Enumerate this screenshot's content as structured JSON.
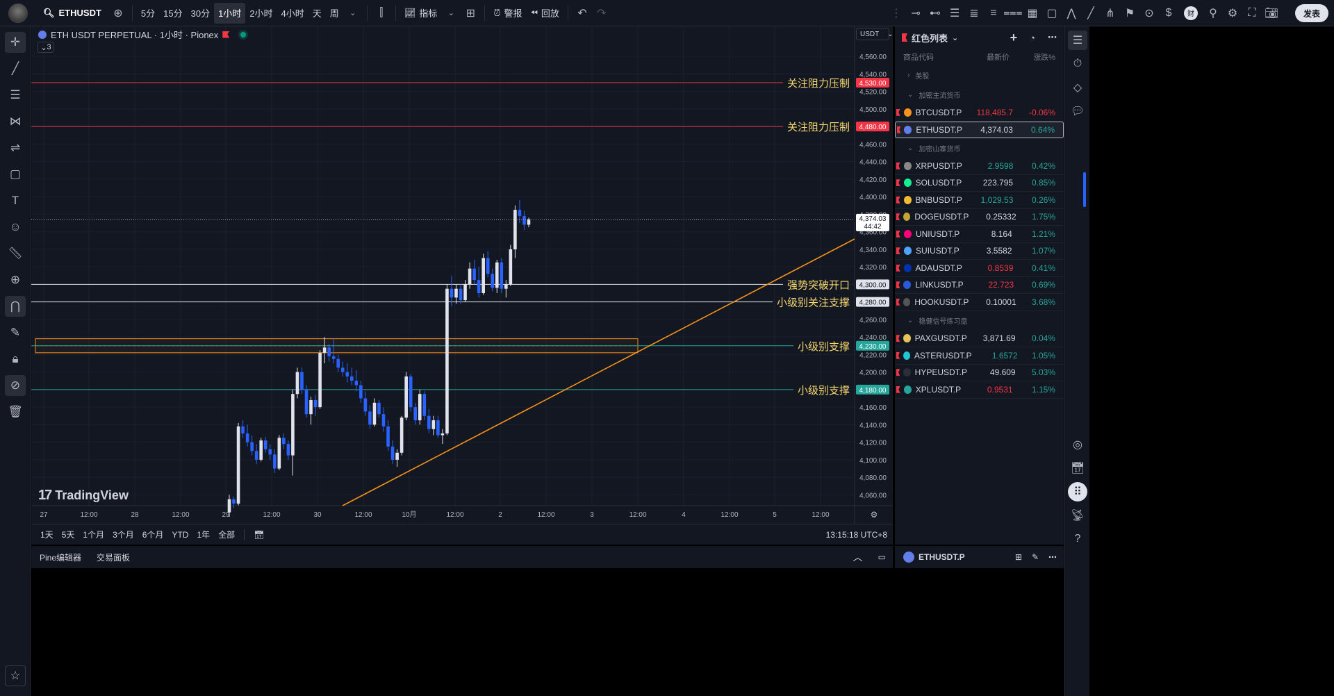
{
  "topbar": {
    "symbol": "ETHUSDT",
    "timeframes": [
      "5分",
      "15分",
      "30分",
      "1小时",
      "2小时",
      "4小时",
      "天",
      "周"
    ],
    "active_timeframe": "1小时",
    "indicators_label": "指标",
    "alert_label": "警报",
    "replay_label": "回放",
    "publish_label": "发表"
  },
  "chart": {
    "title": "ETH USDT PERPETUAL · 1小时 · Pionex",
    "collapse_count": "3",
    "currency": "USDT",
    "watermark": "TradingView",
    "annotations": [
      {
        "text": "关注阻力压制",
        "price": 4530,
        "color": "#f23645",
        "tag": "4,530.00"
      },
      {
        "text": "关注阻力压制",
        "price": 4480,
        "color": "#f23645",
        "tag": "4,480.00"
      },
      {
        "text": "强势突破开口",
        "price": 4300,
        "color": "#e0e3eb",
        "tag": "4,300.00"
      },
      {
        "text": "小级别关注支撑",
        "price": 4280,
        "color": "#e0e3eb",
        "tag": "4,280.00"
      },
      {
        "text": "小级别支撑",
        "price": 4230,
        "color": "#26a69a",
        "tag": "4,230.00"
      },
      {
        "text": "小级别支撑",
        "price": 4180,
        "color": "#26a69a",
        "tag": "4,180.00"
      }
    ],
    "last_price": "4,374.03",
    "countdown": "44:42",
    "price_ticks": [
      "4,560.00",
      "4,540.00",
      "4,520.00",
      "4,500.00",
      "4,480.00",
      "4,460.00",
      "4,440.00",
      "4,420.00",
      "4,400.00",
      "4,380.00",
      "4,360.00",
      "4,340.00",
      "4,320.00",
      "4,300.00",
      "4,280.00",
      "4,260.00",
      "4,240.00",
      "4,220.00",
      "4,200.00",
      "4,180.00",
      "4,160.00",
      "4,140.00",
      "4,120.00",
      "4,100.00",
      "4,080.00",
      "4,060.00"
    ],
    "time_ticks": [
      "27",
      "12:00",
      "28",
      "12:00",
      "29",
      "12:00",
      "30",
      "12:00",
      "10月",
      "12:00",
      "2",
      "12:00",
      "3",
      "12:00",
      "4",
      "12:00",
      "5",
      "12:00"
    ]
  },
  "timeframe_bar": {
    "ranges": [
      "1天",
      "5天",
      "1个月",
      "3个月",
      "6个月",
      "YTD",
      "1年",
      "全部"
    ],
    "clock": "13:15:18 UTC+8"
  },
  "bottom_tabs": [
    "Pine编辑器",
    "交易面板"
  ],
  "watchlist": {
    "title": "红色列表",
    "columns": [
      "商品代码",
      "最新价",
      "涨跌%"
    ],
    "groups": [
      {
        "name": "美股",
        "rows": []
      },
      {
        "name": "加密主流货币",
        "rows": [
          {
            "symbol": "BTCUSDT.P",
            "price": "118,485.7",
            "change": "-0.06%",
            "pcolor": "dn",
            "ccolor": "dn",
            "coin": "#f7931a"
          },
          {
            "symbol": "ETHUSDT.P",
            "price": "4,374.03",
            "change": "0.64%",
            "pcolor": "wt",
            "ccolor": "up",
            "coin": "#627eea",
            "selected": true
          }
        ]
      },
      {
        "name": "加密山寨货币",
        "rows": [
          {
            "symbol": "XRPUSDT.P",
            "price": "2.9598",
            "change": "0.42%",
            "pcolor": "up",
            "ccolor": "up",
            "coin": "#888888"
          },
          {
            "symbol": "SOLUSDT.P",
            "price": "223.795",
            "change": "0.85%",
            "pcolor": "wt",
            "ccolor": "up",
            "coin": "#14f195"
          },
          {
            "symbol": "BNBUSDT.P",
            "price": "1,029.53",
            "change": "0.26%",
            "pcolor": "up",
            "ccolor": "up",
            "coin": "#f3ba2f"
          },
          {
            "symbol": "DOGEUSDT.P",
            "price": "0.25332",
            "change": "1.75%",
            "pcolor": "wt",
            "ccolor": "up",
            "coin": "#c2a633"
          },
          {
            "symbol": "UNIUSDT.P",
            "price": "8.164",
            "change": "1.21%",
            "pcolor": "wt",
            "ccolor": "up",
            "coin": "#ff007a"
          },
          {
            "symbol": "SUIUSDT.P",
            "price": "3.5582",
            "change": "1.07%",
            "pcolor": "wt",
            "ccolor": "up",
            "coin": "#4da2ff"
          },
          {
            "symbol": "ADAUSDT.P",
            "price": "0.8539",
            "change": "0.41%",
            "pcolor": "dn",
            "ccolor": "up",
            "coin": "#0033ad"
          },
          {
            "symbol": "LINKUSDT.P",
            "price": "22.723",
            "change": "0.69%",
            "pcolor": "dn",
            "ccolor": "up",
            "coin": "#2a5ada"
          },
          {
            "symbol": "HOOKUSDT.P",
            "price": "0.10001",
            "change": "3.68%",
            "pcolor": "wt",
            "ccolor": "up",
            "coin": "#555555"
          }
        ]
      },
      {
        "name": "稳健信号练习盘",
        "rows": [
          {
            "symbol": "PAXGUSDT.P",
            "price": "3,871.69",
            "change": "0.04%",
            "pcolor": "wt",
            "ccolor": "up",
            "coin": "#e4c45a"
          },
          {
            "symbol": "ASTERUSDT.P",
            "price": "1.6572",
            "change": "1.05%",
            "pcolor": "up",
            "ccolor": "up",
            "coin": "#1fc7d4"
          },
          {
            "symbol": "HYPEUSDT.P",
            "price": "49.609",
            "change": "5.03%",
            "pcolor": "wt",
            "ccolor": "up",
            "coin": "#2a2e39"
          },
          {
            "symbol": "XPLUSDT.P",
            "price": "0.9531",
            "change": "1.15%",
            "pcolor": "dn",
            "ccolor": "up",
            "coin": "#26a69a"
          }
        ]
      }
    ],
    "footer_symbol": "ETHUSDT.P"
  },
  "colors": {
    "bg": "#131722",
    "up": "#26a69a",
    "down": "#f23645",
    "candle_up": "#e0e3eb",
    "candle_down": "#2962ff",
    "trend": "#f7931a",
    "label": "#f5d76e"
  }
}
